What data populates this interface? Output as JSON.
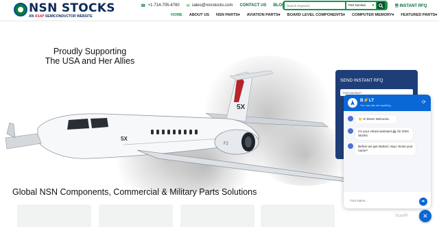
{
  "header": {
    "logo": {
      "name": "NSN STOCKS",
      "tagline_prefix": "AN",
      "tagline_brand": "ASAP",
      "tagline_suffix": "SEMICONDUCTOR WEBSITE"
    },
    "phone": "+1-714-705-4780",
    "email": "sales@nsnstocks.com",
    "contact_link": "CONTACT US",
    "blog_link": "BLOG",
    "search": {
      "placeholder": "Search Keyword",
      "select_value": "Part Number",
      "button_icon": "search-icon"
    },
    "rfq_link": "INSTANT RFQ"
  },
  "nav": {
    "items": [
      {
        "label": "HOME",
        "active": true
      },
      {
        "label": "ABOUT US"
      },
      {
        "label": "NSN PARTS▾"
      },
      {
        "label": "AVIATION PARTS▾"
      },
      {
        "label": "BOARD LEVEL COMPONENTS▾"
      },
      {
        "label": "COMPUTER MEMORY▾"
      },
      {
        "label": "FEATURED PARTS▾"
      }
    ]
  },
  "hero": {
    "title_line1": "Proudly Supporting",
    "title_line2": "The USA and Her Allies",
    "plane_tail": "5X",
    "plane_nose": "5X",
    "plane_engine": "F2"
  },
  "section": {
    "title": "Global NSN Components, Commercial & Military Parts Solutions"
  },
  "rfq_panel": {
    "title": "SEND INSTANT RFQ",
    "part_placeholder": "Part Number*"
  },
  "chat": {
    "name": "B⚡LT",
    "subtitle": "You can ask me anything",
    "messages": [
      "👋 Hi there! Welcome.",
      "I'm your virtual assistant 🤖 for NSN Stocks",
      "Before we get started, may I know your name?"
    ],
    "input_placeholder": "Your Name...",
    "send_label": "⮕",
    "close_icon": "✕"
  },
  "scroll_top": "ScanPi",
  "colors": {
    "brand_green": "#17914a",
    "brand_navy": "#0d2a59",
    "chat_blue": "#0a67d6",
    "rfq_navy": "#1f3e78"
  }
}
